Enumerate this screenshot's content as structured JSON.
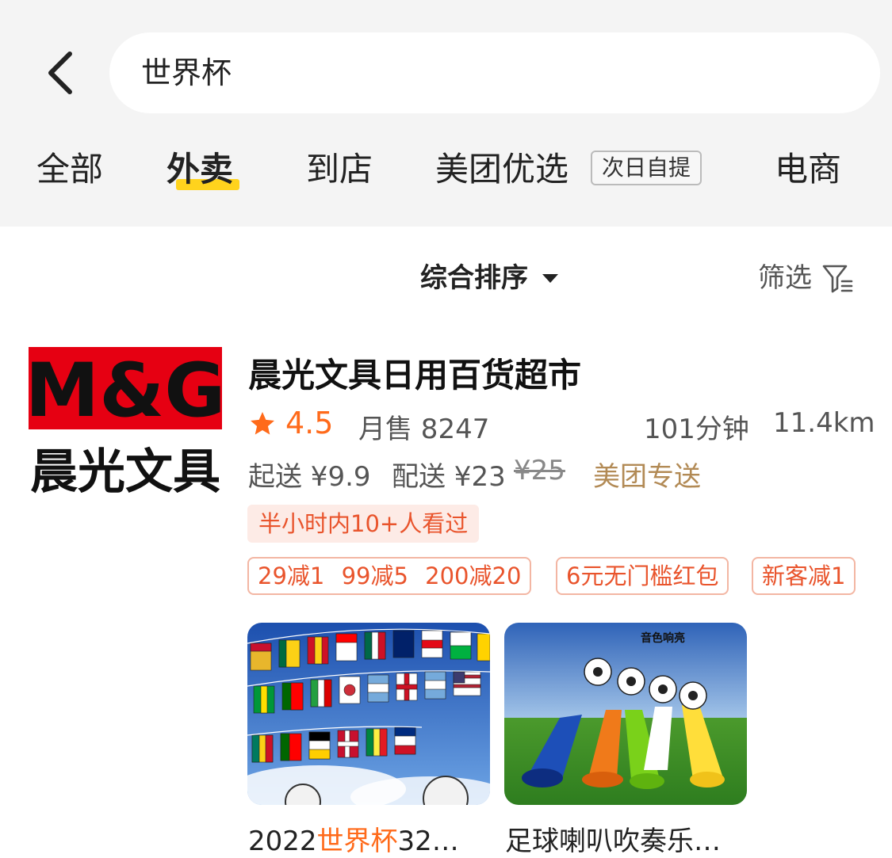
{
  "header": {
    "back_icon": "chevron-left-icon",
    "search_query": "世界杯"
  },
  "tabs": [
    {
      "label": "全部",
      "active": false
    },
    {
      "label": "外卖",
      "active": true
    },
    {
      "label": "到店",
      "active": false
    },
    {
      "label": "美团优选",
      "badge": "次日自提",
      "active": false
    },
    {
      "label": "电商",
      "active": false
    }
  ],
  "sort_bar": {
    "sort_label": "综合排序",
    "filter_label": "筛选",
    "filter_icon": "filter-icon"
  },
  "store": {
    "logo_top": "M&G",
    "logo_bottom": "晨光文具",
    "name": "晨光文具日用百货超市",
    "rating": "4.5",
    "monthly_sales": "月售 8247",
    "delivery_time": "101分钟",
    "distance": "11.4km",
    "min_order": "起送 ¥9.9",
    "delivery_fee": "配送 ¥23",
    "original_fee": "¥25",
    "delivery_type": "美团专送",
    "views_tag": "半小时内10+人看过",
    "promos": {
      "full_reduction": [
        "29减1",
        "99减5",
        "200减20"
      ],
      "red_packet": "6元无门槛红包",
      "new_customer": "新客减1"
    },
    "products": [
      {
        "title_prefix": "2022",
        "title_highlight": "世界杯",
        "title_suffix": "32…"
      },
      {
        "title": "足球喇叭吹奏乐…",
        "image_caption": "音色响亮"
      }
    ]
  },
  "colors": {
    "accent_orange": "#ff6a1a",
    "tab_underline": "#ffd31d",
    "promo_red": "#e9542c",
    "delivery_gold": "#b28a55",
    "header_bg": "#f4f4f4",
    "logo_red": "#e60012"
  }
}
